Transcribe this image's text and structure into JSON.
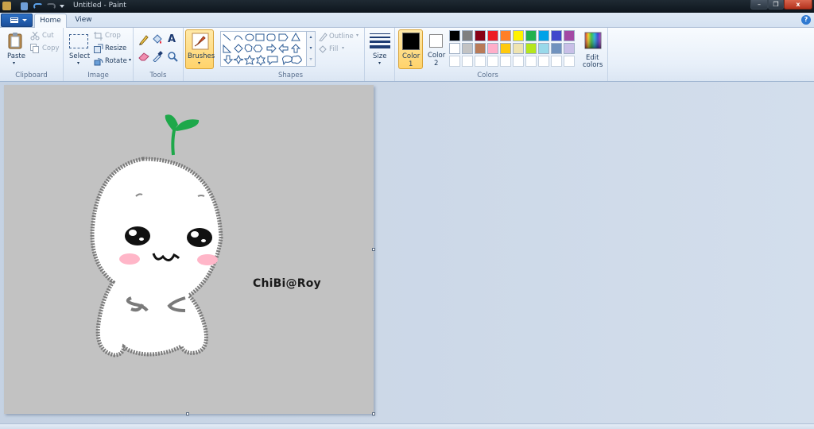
{
  "window": {
    "title": "Untitled - Paint",
    "minimize": "–",
    "maximize": "❐",
    "close": "x"
  },
  "tabs": [
    {
      "label": "Home",
      "active": true
    },
    {
      "label": "View",
      "active": false
    }
  ],
  "app_menu_icon": "menu-lines-icon",
  "ribbon": {
    "clipboard": {
      "paste": "Paste",
      "cut": "Cut",
      "copy": "Copy",
      "group": "Clipboard"
    },
    "image": {
      "select": "Select",
      "crop": "Crop",
      "resize": "Resize",
      "rotate": "Rotate",
      "group": "Image"
    },
    "tools": {
      "group": "Tools",
      "text_glyph": "A"
    },
    "brushes": {
      "label": "Brushes"
    },
    "shapes": {
      "outline": "Outline",
      "fill": "Fill",
      "group": "Shapes"
    },
    "size": {
      "label": "Size"
    },
    "colors": {
      "color1_label": "Color",
      "color1_num": "1",
      "color2_label": "Color",
      "color2_num": "2",
      "edit_label": "Edit",
      "edit_label2": "colors",
      "group": "Colors",
      "color1": "#000000",
      "color2": "#ffffff",
      "palette": [
        [
          "#000000",
          "#7f7f7f",
          "#880015",
          "#ed1c24",
          "#ff7f27",
          "#fff200",
          "#22b14c",
          "#00a2e8",
          "#3f48cc",
          "#a349a4"
        ],
        [
          "#ffffff",
          "#c3c3c3",
          "#b97a57",
          "#ffaec9",
          "#ffc90e",
          "#efe4b0",
          "#b5e61d",
          "#99d9ea",
          "#7092be",
          "#c8bfe7"
        ],
        [
          "#ffffff",
          "#ffffff",
          "#ffffff",
          "#ffffff",
          "#ffffff",
          "#ffffff",
          "#ffffff",
          "#ffffff",
          "#ffffff",
          "#ffffff"
        ]
      ]
    }
  },
  "canvas": {
    "background": "#c2c2c2",
    "signature": "ChiBi@Roy"
  }
}
